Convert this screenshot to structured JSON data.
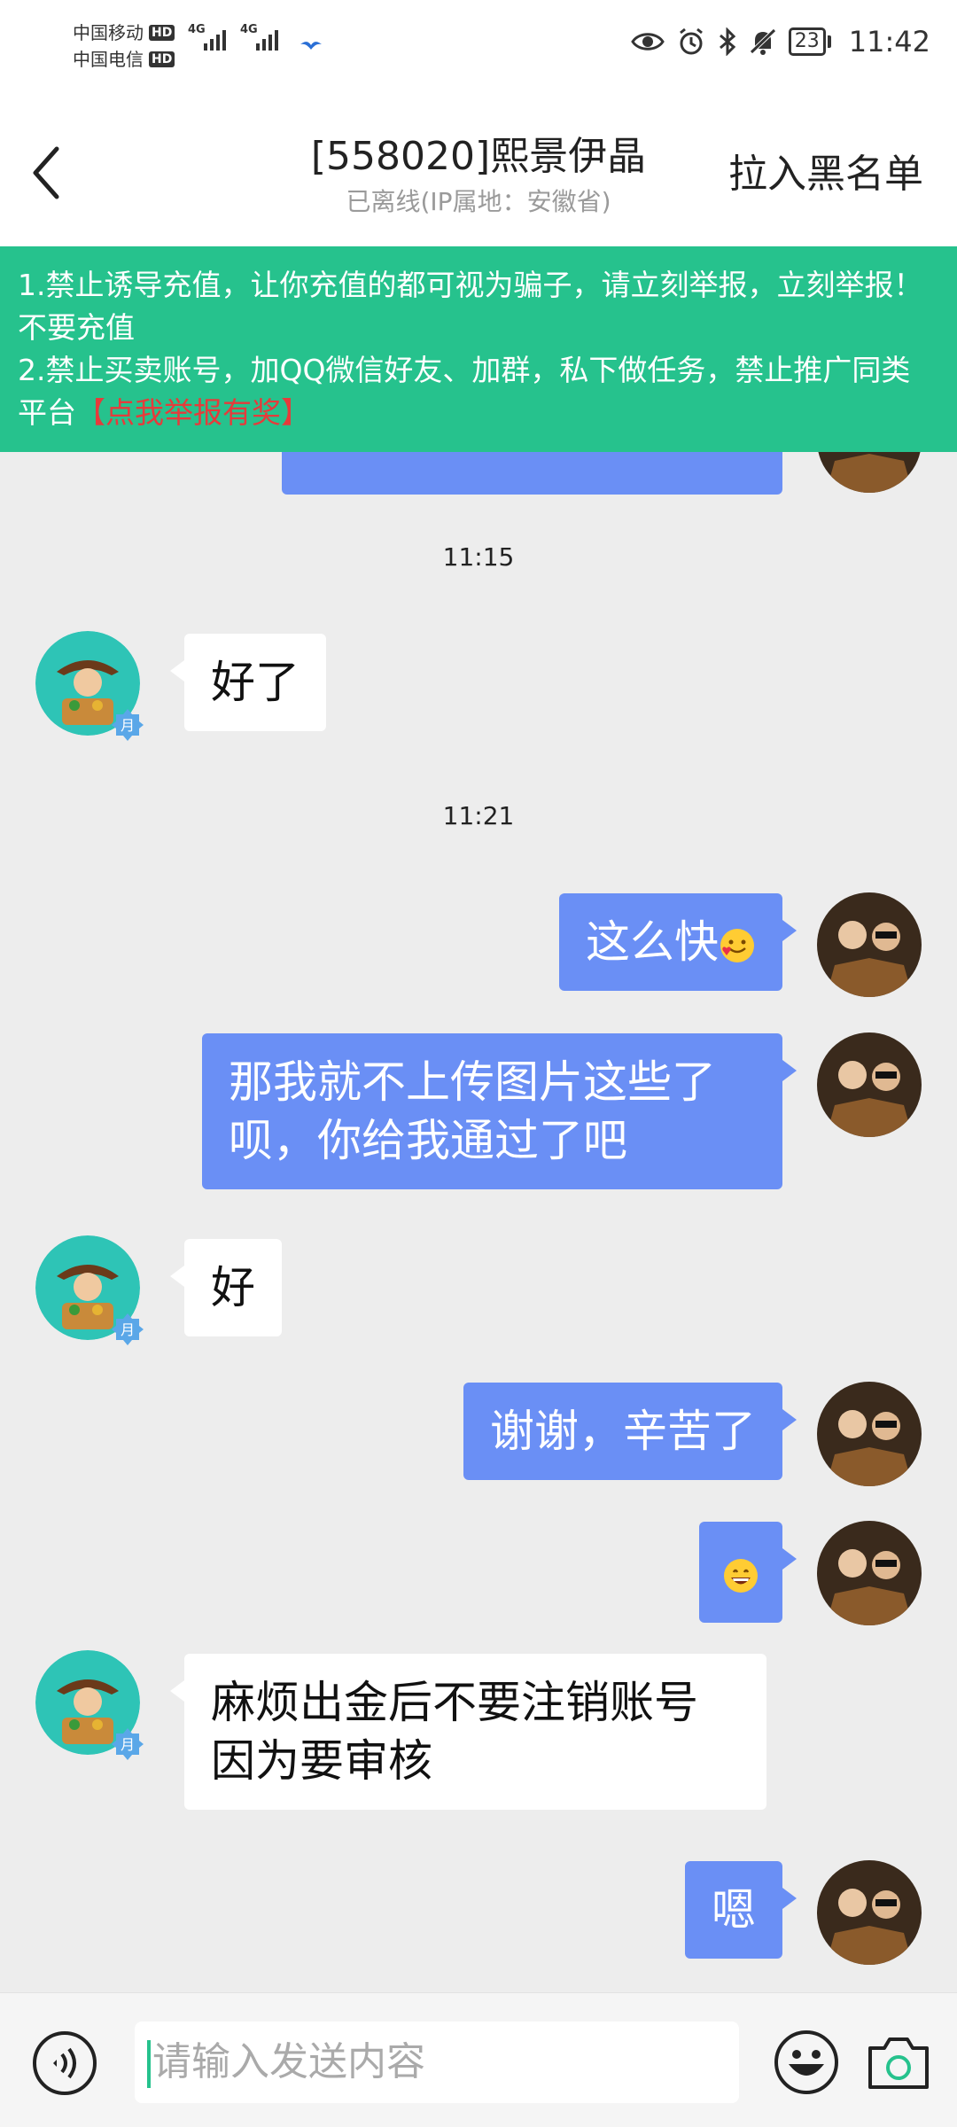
{
  "status_bar": {
    "carrier1": "中国移动",
    "carrier2": "中国电信",
    "hd": "HD",
    "net1": "4G",
    "net2": "4G",
    "battery": "23",
    "time": "11:42"
  },
  "header": {
    "title": "[558020]熙景伊晶",
    "subtitle": "已离线(IP属地：安徽省)",
    "blacklist_label": "拉入黑名单"
  },
  "notice": {
    "line1": "1.禁止诱导充值，让你充值的都可视为骗子，请立刻举报，立刻举报！不要充值",
    "line2": "2.禁止买卖账号，加QQ微信好友、加群，私下做任务，禁止推广同类平台",
    "report_link": "【点我举报有奖】"
  },
  "chat": {
    "messages": [
      {
        "type": "timestamp",
        "text": "11:15"
      },
      {
        "type": "left",
        "text": "好了",
        "badge": "月"
      },
      {
        "type": "timestamp",
        "text": "11:21"
      },
      {
        "type": "right",
        "text": "这么快",
        "emoji": "smiling-face-with-hearts-emoji"
      },
      {
        "type": "right",
        "text": "那我就不上传图片这些了呗，你给我通过了吧"
      },
      {
        "type": "left",
        "text": "好",
        "badge": "月"
      },
      {
        "type": "right",
        "text": "谢谢，辛苦了"
      },
      {
        "type": "right",
        "text": "",
        "emoji": "grinning-face-emoji"
      },
      {
        "type": "left",
        "text": "麻烦出金后不要注销账号因为要审核",
        "badge": "月"
      },
      {
        "type": "right",
        "text": "嗯"
      }
    ]
  },
  "input_bar": {
    "placeholder": "请输入发送内容",
    "icons": [
      "voice-icon",
      "emoji-icon",
      "camera-icon"
    ]
  },
  "colors": {
    "notice_bg": "#26c28d",
    "bubble_right": "#6a8ff5",
    "bubble_left": "#ffffff",
    "report_link": "#e63b3b",
    "chat_bg": "#ededed"
  }
}
